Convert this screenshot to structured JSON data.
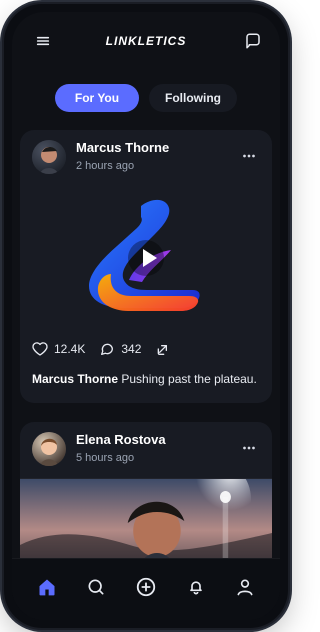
{
  "app": {
    "brand": "LINKLETICS"
  },
  "tabs": [
    {
      "label": "For You",
      "active": true
    },
    {
      "label": "Following",
      "active": false
    }
  ],
  "posts": [
    {
      "author": "Marcus Thorne",
      "time": "2 hours ago",
      "likes": "12.4K",
      "comments": "342",
      "caption": "Pushing past the plateau."
    },
    {
      "author": "Elena Rostova",
      "time": "5 hours ago"
    }
  ],
  "icons": {
    "menu": "menu-icon",
    "chat": "chat-icon",
    "more": "more-icon",
    "like": "heart-icon",
    "comment": "comment-icon",
    "share": "share-icon",
    "home": "home-icon",
    "search": "search-icon",
    "add": "add-icon",
    "notifications": "bell-icon",
    "profile": "user-icon"
  },
  "colors": {
    "accent": "#5b6cff",
    "background": "#0f1116",
    "card": "#181b23",
    "nav_active": "#5b6cff"
  }
}
